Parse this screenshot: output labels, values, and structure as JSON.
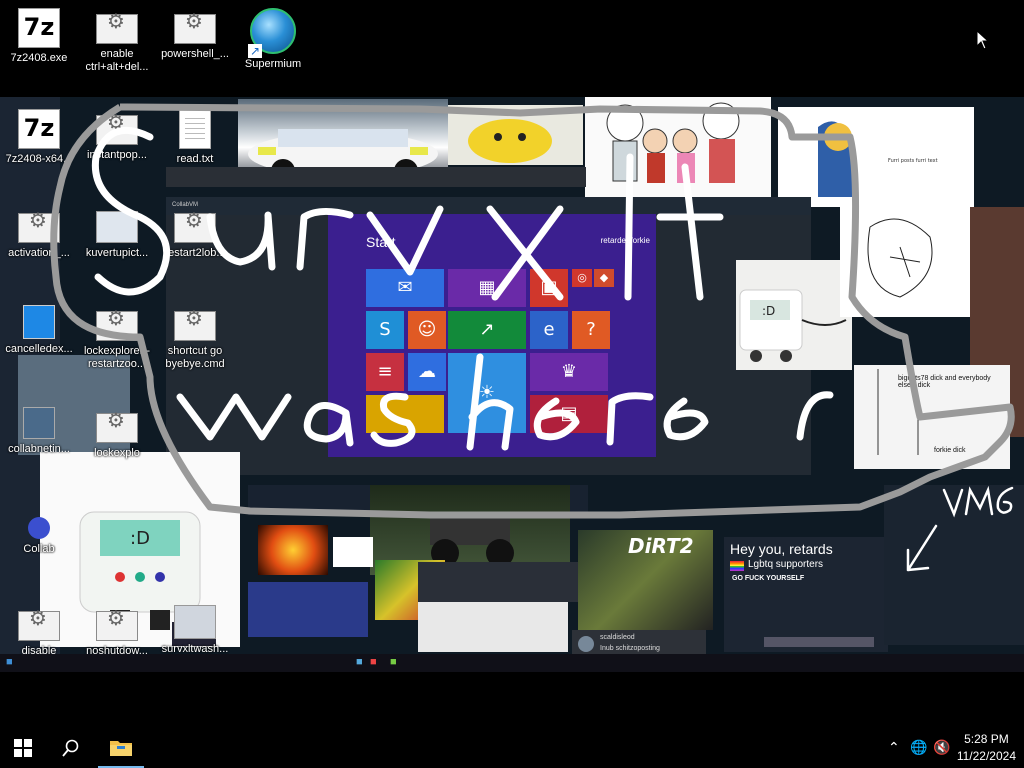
{
  "desktop_icons": {
    "top": [
      {
        "label": "7z2408.exe"
      },
      {
        "label": "enable ctrl+alt+del..."
      },
      {
        "label": "powershell_..."
      },
      {
        "label": "Supermium"
      }
    ],
    "inner": [
      {
        "label": "7z2408-x64..."
      },
      {
        "label": "instantpop..."
      },
      {
        "label": "read.txt"
      },
      {
        "label": "activation_..."
      },
      {
        "label": "kuvertupict..."
      },
      {
        "label": "restart2lob..."
      },
      {
        "label": "cancelledex..."
      },
      {
        "label": "lockexplorer - restartzoo..."
      },
      {
        "label": "shortcut go byebye.cmd"
      },
      {
        "label": "collabnetin..."
      },
      {
        "label": "lockexplo"
      },
      {
        "label": "Collab"
      },
      {
        "label": "disable ctrl+alt+del..."
      },
      {
        "label": "noshutdow..."
      },
      {
        "label": "survxltwash..."
      }
    ]
  },
  "collage": {
    "win8_start": "Start",
    "win8_user": "retardedforkie",
    "scribble_line1": "Survxlt",
    "scribble_line2": "was here",
    "scribble_tag": "VM6",
    "browser_site": "CollabVM",
    "meme_title": "Hey you, retards",
    "meme_sub": "Lgbtq supporters",
    "meme_line": "GO FUCK YOURSELF",
    "dirt_title": "DiRT2",
    "chat_user": "scaldisleod",
    "chat_msg": "Inub schitzoposting",
    "sketch_text": "forkie dick",
    "sketch_text2": "bignuts78 dick and everybody else's dick"
  },
  "taskbar": {
    "time": "5:28 PM",
    "date": "11/22/2024"
  },
  "colors": {
    "win8_bg": "#3b1f8f",
    "taskbar_bg": "#000000"
  }
}
